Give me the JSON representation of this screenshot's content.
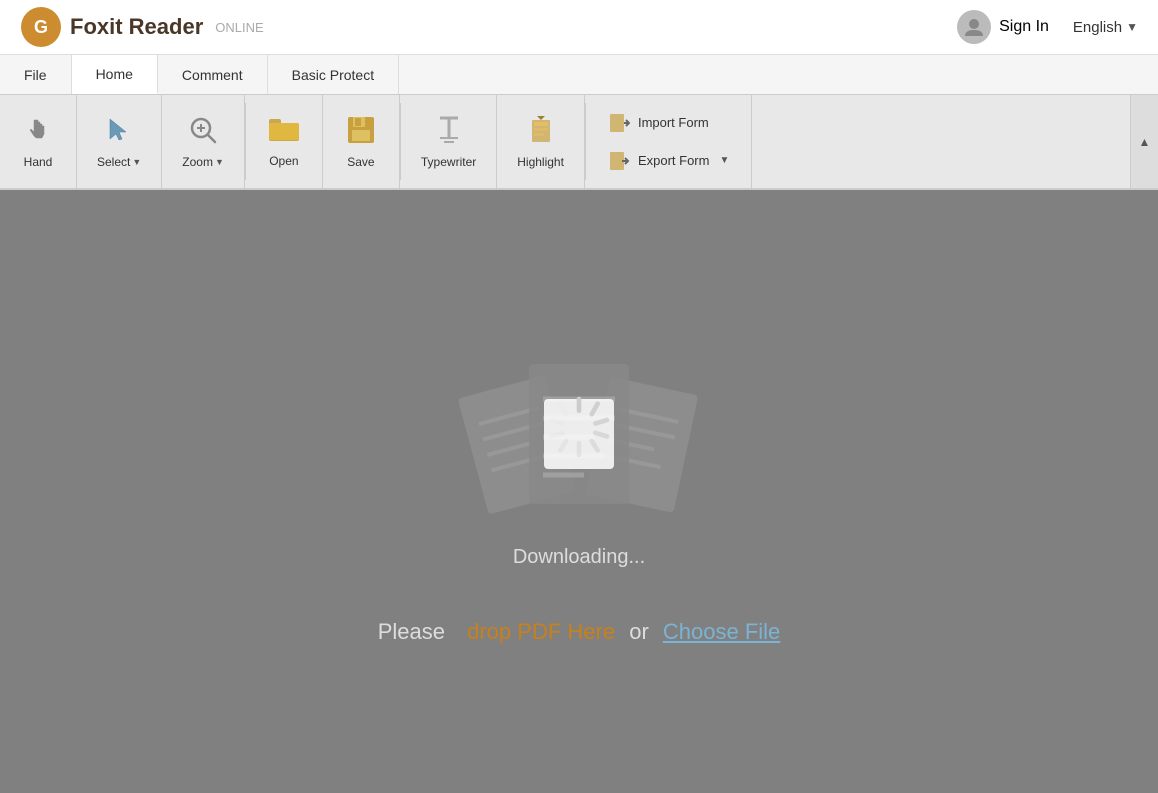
{
  "header": {
    "logo_main": "Foxit Reader",
    "logo_suffix": "ONLINE",
    "sign_in_label": "Sign In",
    "language": "English"
  },
  "tabs": {
    "items": [
      {
        "id": "file",
        "label": "File"
      },
      {
        "id": "home",
        "label": "Home",
        "active": true
      },
      {
        "id": "comment",
        "label": "Comment"
      },
      {
        "id": "basic_protect",
        "label": "Basic Protect"
      }
    ]
  },
  "toolbar": {
    "tools": [
      {
        "id": "hand",
        "label": "Hand",
        "icon": "hand"
      },
      {
        "id": "select",
        "label": "Select",
        "icon": "select",
        "hasArrow": true
      },
      {
        "id": "zoom",
        "label": "Zoom",
        "icon": "zoom",
        "hasArrow": true
      },
      {
        "id": "open",
        "label": "Open",
        "icon": "open"
      },
      {
        "id": "save",
        "label": "Save",
        "icon": "save"
      },
      {
        "id": "typewriter",
        "label": "Typewriter",
        "icon": "typewriter"
      },
      {
        "id": "highlight",
        "label": "Highlight",
        "icon": "highlight"
      }
    ],
    "form_buttons": [
      {
        "id": "import_form",
        "label": "Import Form",
        "hasArrow": false
      },
      {
        "id": "export_form",
        "label": "Export Form",
        "hasArrow": true
      }
    ]
  },
  "main": {
    "downloading_text": "Downloading...",
    "drop_text_before": "Please",
    "drop_link": "drop PDF Here",
    "drop_text_middle": "or",
    "choose_link": "Choose File"
  },
  "scroll_up_icon": "▲"
}
